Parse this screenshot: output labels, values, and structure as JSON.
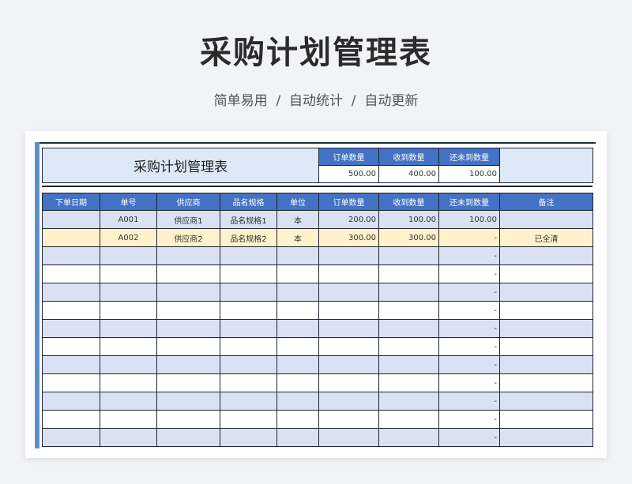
{
  "page": {
    "title": "采购计划管理表",
    "subtitle": "简单易用  /  自动统计  /  自动更新"
  },
  "summary": {
    "title": "采购计划管理表",
    "headers": [
      "订单数量",
      "收到数量",
      "还未到数量"
    ],
    "values": [
      "500.00",
      "400.00",
      "100.00"
    ]
  },
  "table": {
    "columns": [
      "下单日期",
      "单号",
      "供应商",
      "品名规格",
      "单位",
      "订单数量",
      "收到数量",
      "还未到数量",
      "备注"
    ],
    "rows": [
      [
        "",
        "A001",
        "供应商1",
        "品名规格1",
        "本",
        "200.00",
        "100.00",
        "100.00",
        ""
      ],
      [
        "",
        "A002",
        "供应商2",
        "品名规格2",
        "本",
        "300.00",
        "300.00",
        "-",
        "已全清"
      ],
      [
        "",
        "",
        "",
        "",
        "",
        "",
        "",
        "-",
        ""
      ],
      [
        "",
        "",
        "",
        "",
        "",
        "",
        "",
        "-",
        ""
      ],
      [
        "",
        "",
        "",
        "",
        "",
        "",
        "",
        "-",
        ""
      ],
      [
        "",
        "",
        "",
        "",
        "",
        "",
        "",
        "-",
        ""
      ],
      [
        "",
        "",
        "",
        "",
        "",
        "",
        "",
        "-",
        ""
      ],
      [
        "",
        "",
        "",
        "",
        "",
        "",
        "",
        "-",
        ""
      ],
      [
        "",
        "",
        "",
        "",
        "",
        "",
        "",
        "-",
        ""
      ],
      [
        "",
        "",
        "",
        "",
        "",
        "",
        "",
        "-",
        ""
      ],
      [
        "",
        "",
        "",
        "",
        "",
        "",
        "",
        "-",
        ""
      ],
      [
        "",
        "",
        "",
        "",
        "",
        "",
        "",
        "-",
        ""
      ],
      [
        "",
        "",
        "",
        "",
        "",
        "",
        "",
        "-",
        ""
      ]
    ]
  },
  "colors": {
    "header_blue": "#4472c4",
    "row_band": "#d9e1f2",
    "highlight_row": "#fff1cc",
    "accent_bar": "#5b8fc9"
  }
}
